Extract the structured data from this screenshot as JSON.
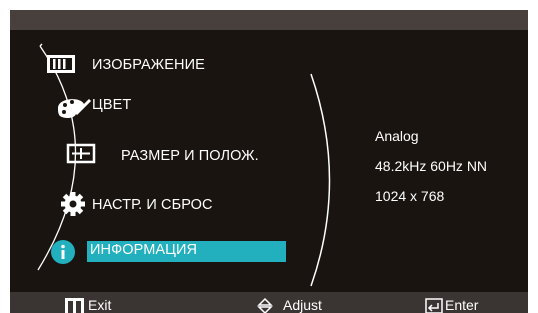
{
  "menu": {
    "items": [
      {
        "id": "picture",
        "label": "ИЗОБРАЖЕНИЕ",
        "icon": "picture-bars-icon"
      },
      {
        "id": "color",
        "label": "ЦВЕТ",
        "icon": "palette-icon"
      },
      {
        "id": "size-position",
        "label": "РАЗМЕР И ПОЛОЖ.",
        "icon": "size-position-icon"
      },
      {
        "id": "setup-reset",
        "label": "НАСТР. И СБРОС",
        "icon": "gear-icon"
      },
      {
        "id": "information",
        "label": "ИНФОРМАЦИЯ",
        "icon": "info-icon",
        "selected": true
      }
    ]
  },
  "info_panel": {
    "source": "Analog",
    "frequency": "48.2kHz 60Hz NN",
    "resolution": "1024 x 768"
  },
  "footer": {
    "exit_label": "Exit",
    "adjust_label": "Adjust",
    "enter_label": "Enter"
  },
  "colors": {
    "background": "#191410",
    "highlight": "#22b0bf",
    "text": "#ffffff",
    "topbar": "#47403c",
    "footer": "#3a3532"
  }
}
